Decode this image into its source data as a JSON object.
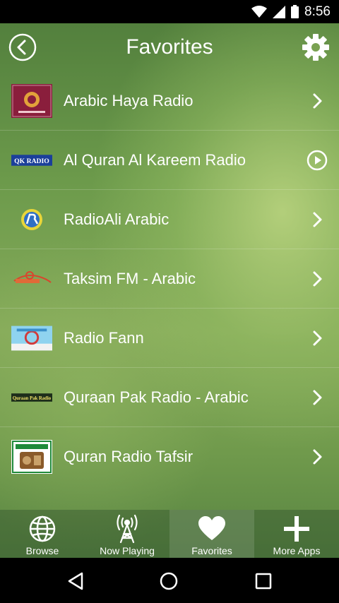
{
  "status_bar": {
    "time": "8:56",
    "icons": [
      "wifi-icon",
      "cell-signal-icon",
      "battery-icon"
    ]
  },
  "app_bar": {
    "title": "Favorites",
    "back_icon": "back-arrow-icon",
    "settings_icon": "gear-icon"
  },
  "stations": [
    {
      "name": "Arabic Haya Radio",
      "logo": "haya-logo",
      "action": "chevron-right-icon"
    },
    {
      "name": "Al Quran Al Kareem Radio",
      "logo": "qk-radio-logo",
      "logo_text": "QK RADIO",
      "action": "play-circle-icon"
    },
    {
      "name": "RadioAli Arabic",
      "logo": "radioali-logo",
      "action": "chevron-right-icon"
    },
    {
      "name": "Taksim FM - Arabic",
      "logo": "taksim-logo",
      "action": "chevron-right-icon"
    },
    {
      "name": "Radio Fann",
      "logo": "radio-fann-logo",
      "action": "chevron-right-icon"
    },
    {
      "name": "Quraan Pak Radio - Arabic",
      "logo": "quraan-pak-logo",
      "logo_text": "Quraan Pak Radio",
      "action": "chevron-right-icon"
    },
    {
      "name": "Quran Radio Tafsir",
      "logo": "quran-tafsir-logo",
      "action": "chevron-right-icon"
    }
  ],
  "tabs": [
    {
      "label": "Browse",
      "icon": "globe-icon",
      "active": false
    },
    {
      "label": "Now Playing",
      "icon": "antenna-icon",
      "active": false
    },
    {
      "label": "Favorites",
      "icon": "heart-icon",
      "active": true
    },
    {
      "label": "More Apps",
      "icon": "plus-icon",
      "active": false
    }
  ],
  "nav_bar": {
    "icons": [
      "nav-back-icon",
      "nav-home-icon",
      "nav-recents-icon"
    ]
  },
  "colors": {
    "status_bar": "#000000",
    "text": "#ffffff",
    "background_green": "#6c9a4b"
  }
}
